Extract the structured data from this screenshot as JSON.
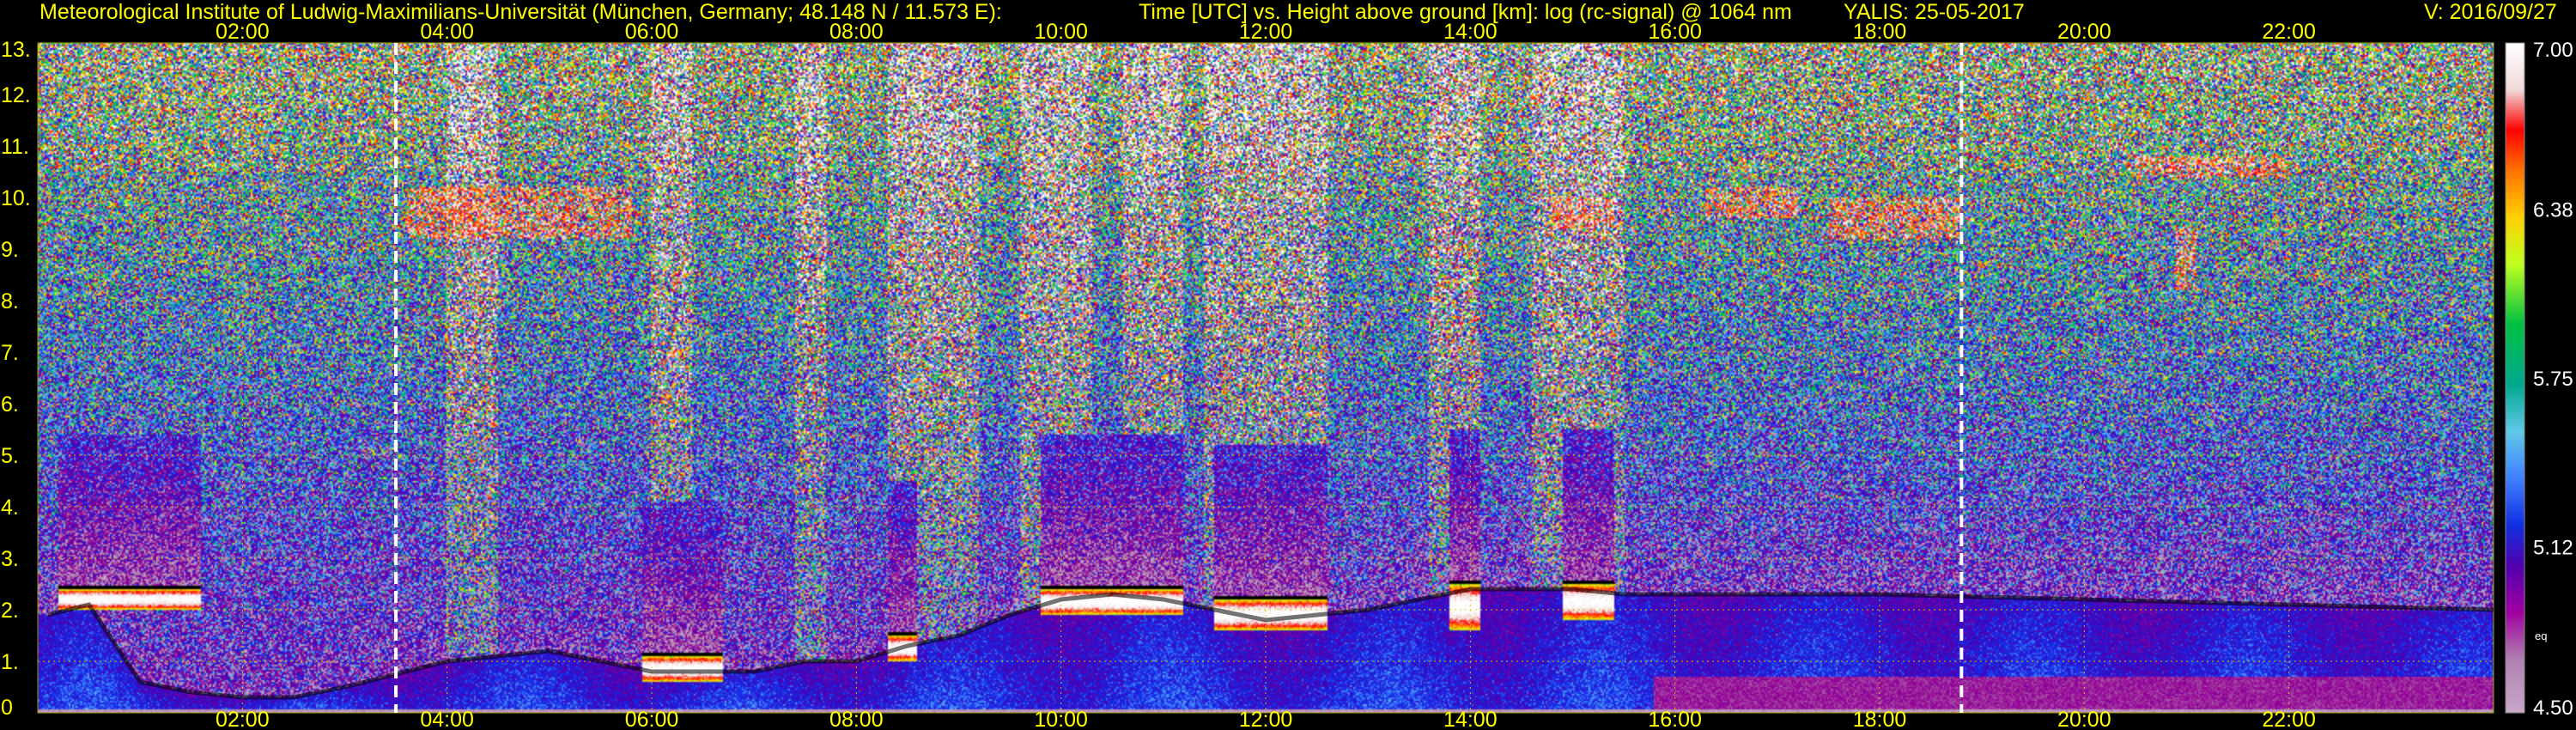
{
  "header": {
    "institute": "Meteorological Institute of Ludwig-Maximilians-Universität (München, Germany; 48.148 N / 11.573 E):",
    "axes_title": "Time [UTC] vs. Height above ground [km]: log (rc-signal) @ 1064 nm",
    "station_date": "YALIS: 25-05-2017",
    "version": "V: 2016/09/27"
  },
  "colorbar": {
    "ticks": [
      "7.00",
      "6.38",
      "5.75",
      "5.12",
      "4.50"
    ],
    "unit": "eq"
  },
  "chart_data": {
    "type": "heatmap",
    "title": "Time [UTC] vs. Height above ground [km]: log (rc-signal) @ 1064 nm",
    "xlabel": "Time [UTC]",
    "ylabel": "Height above ground [km]",
    "x_ticks": [
      "02:00",
      "04:00",
      "06:00",
      "08:00",
      "10:00",
      "12:00",
      "14:00",
      "16:00",
      "18:00",
      "20:00",
      "22:00"
    ],
    "x_tick_hours": [
      2,
      4,
      6,
      8,
      10,
      12,
      14,
      16,
      18,
      20,
      22
    ],
    "xlim_hours": [
      0.0,
      24.0
    ],
    "y_ticks": [
      "0",
      "1.",
      "2.",
      "3.",
      "4.",
      "5.",
      "6.",
      "7.",
      "8.",
      "9.",
      "10.",
      "11.",
      "12.",
      "13."
    ],
    "y_tick_km": [
      0,
      1,
      2,
      3,
      4,
      5,
      6,
      7,
      8,
      9,
      10,
      11,
      12,
      13
    ],
    "ylim_km": [
      0,
      13
    ],
    "color_range": [
      4.5,
      7.0
    ],
    "colorbar_ticks": [
      7.0,
      6.38,
      5.75,
      5.12,
      4.5
    ],
    "grid": true,
    "dashed_lines_hours": [
      3.5,
      18.8
    ],
    "boundary_layer_top_km": [
      [
        0.1,
        1.9
      ],
      [
        0.5,
        2.1
      ],
      [
        1.0,
        0.6
      ],
      [
        1.5,
        0.4
      ],
      [
        2.0,
        0.3
      ],
      [
        2.5,
        0.3
      ],
      [
        3.0,
        0.5
      ],
      [
        4.0,
        1.0
      ],
      [
        5.0,
        1.2
      ],
      [
        6.0,
        0.8
      ],
      [
        7.0,
        0.8
      ],
      [
        7.5,
        1.0
      ],
      [
        8.0,
        1.0
      ],
      [
        8.5,
        1.3
      ],
      [
        9.0,
        1.5
      ],
      [
        9.5,
        1.9
      ],
      [
        10.0,
        2.2
      ],
      [
        10.5,
        2.3
      ],
      [
        11.0,
        2.2
      ],
      [
        11.5,
        2.0
      ],
      [
        12.0,
        1.8
      ],
      [
        12.5,
        1.9
      ],
      [
        13.0,
        2.0
      ],
      [
        13.5,
        2.2
      ],
      [
        14.0,
        2.4
      ],
      [
        14.5,
        2.4
      ],
      [
        15.0,
        2.4
      ],
      [
        15.5,
        2.3
      ],
      [
        16.0,
        2.3
      ],
      [
        18.0,
        2.3
      ],
      [
        20.0,
        2.2
      ],
      [
        22.0,
        2.1
      ],
      [
        24.0,
        2.0
      ]
    ],
    "clouds_km": [
      {
        "hours": [
          0.2,
          1.6
        ],
        "base": 2.0,
        "top": 2.4
      },
      {
        "hours": [
          5.9,
          6.7
        ],
        "base": 0.6,
        "top": 1.1
      },
      {
        "hours": [
          8.3,
          8.6
        ],
        "base": 1.0,
        "top": 1.5
      },
      {
        "hours": [
          9.8,
          11.2
        ],
        "base": 1.9,
        "top": 2.4
      },
      {
        "hours": [
          11.5,
          12.6
        ],
        "base": 1.6,
        "top": 2.2
      },
      {
        "hours": [
          13.8,
          14.1
        ],
        "base": 1.6,
        "top": 2.5
      },
      {
        "hours": [
          14.9,
          15.4
        ],
        "base": 1.8,
        "top": 2.5
      }
    ],
    "high_noise_hours": [
      [
        4.0,
        4.5
      ],
      [
        6.0,
        6.4
      ],
      [
        7.4,
        7.7
      ],
      [
        8.3,
        9.2
      ],
      [
        9.6,
        10.3
      ],
      [
        10.6,
        11.2
      ],
      [
        11.4,
        12.6
      ],
      [
        13.6,
        14.1
      ],
      [
        14.6,
        15.5
      ]
    ],
    "cirrus_km": [
      {
        "hours": [
          3.6,
          5.8
        ],
        "base": 9.2,
        "top": 10.2
      },
      {
        "hours": [
          14.8,
          15.4
        ],
        "base": 9.4,
        "top": 10.0
      },
      {
        "hours": [
          16.3,
          17.2
        ],
        "base": 9.6,
        "top": 10.2
      },
      {
        "hours": [
          17.5,
          18.8
        ],
        "base": 9.2,
        "top": 10.0
      },
      {
        "hours": [
          20.5,
          22.0
        ],
        "base": 10.4,
        "top": 10.8
      },
      {
        "hours": [
          20.9,
          21.1
        ],
        "base": 8.2,
        "top": 9.4
      }
    ]
  }
}
